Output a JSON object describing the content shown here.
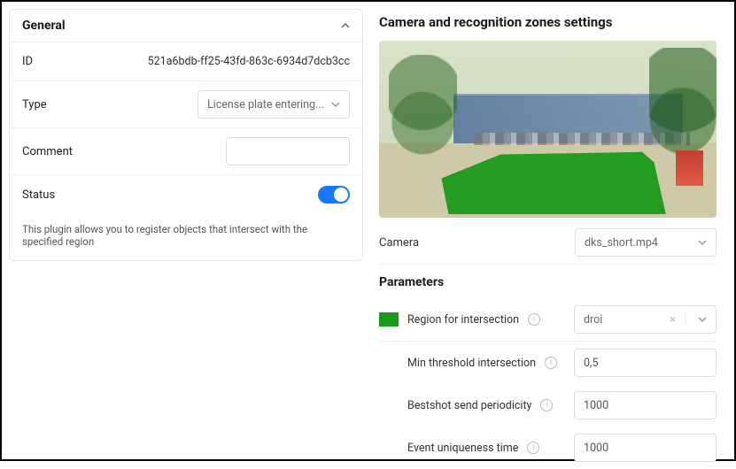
{
  "general": {
    "title": "General",
    "id_label": "ID",
    "id_value": "521a6bdb-ff25-43fd-863c-6934d7dcb3cc",
    "type_label": "Type",
    "type_value": "License plate entering...",
    "comment_label": "Comment",
    "comment_value": "",
    "status_label": "Status",
    "status_on": true,
    "description": "This plugin allows you to register objects that intersect with the specified region"
  },
  "right": {
    "title": "Camera and recognition zones settings",
    "preview_timestamp": "",
    "camera_label": "Camera",
    "camera_value": "dks_short.mp4",
    "params_title": "Parameters",
    "region_label": "Region for intersection",
    "region_value": "droi",
    "min_threshold_label": "Min threshold intersection",
    "min_threshold_value": "0,5",
    "bestshot_label": "Bestshot send periodicity",
    "bestshot_value": "1000",
    "uniqueness_label": "Event uniqueness time",
    "uniqueness_value": "1000"
  }
}
